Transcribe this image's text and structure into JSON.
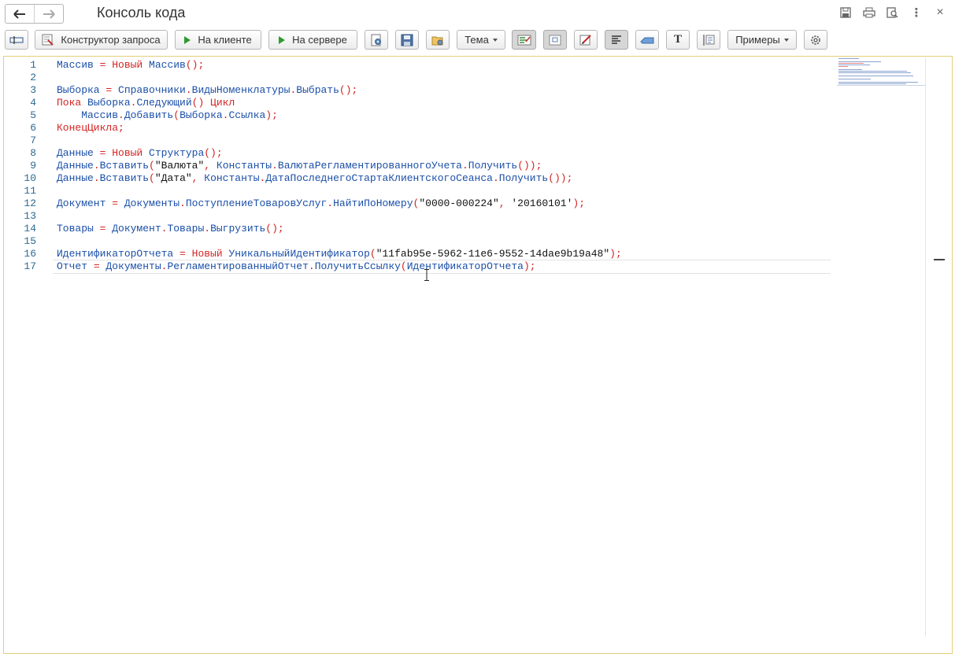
{
  "window": {
    "title": "Консоль кода",
    "nav_back": "back-arrow-icon",
    "nav_forward": "forward-arrow-icon",
    "window_icons": [
      "save-icon",
      "print-icon",
      "preview-icon",
      "more-icon",
      "close-icon"
    ],
    "close_glyph": "×",
    "more_glyph": "⋮"
  },
  "toolbar": {
    "query_builder_label": "Конструктор запроса",
    "run_client_label": "На клиенте",
    "run_server_label": "На сервере",
    "theme_label": "Тема",
    "examples_label": "Примеры",
    "text_button_label": "T"
  },
  "editor": {
    "current_line": 17,
    "lines": [
      {
        "n": "1",
        "tokens": [
          [
            "id",
            "Массив"
          ],
          [
            "op",
            " = "
          ],
          [
            "kw",
            "Новый"
          ],
          [
            "id",
            " Массив"
          ],
          [
            "op",
            "();"
          ]
        ]
      },
      {
        "n": "2",
        "tokens": []
      },
      {
        "n": "3",
        "tokens": [
          [
            "id",
            "Выборка"
          ],
          [
            "op",
            " = "
          ],
          [
            "id",
            "Справочники"
          ],
          [
            "op",
            "."
          ],
          [
            "id",
            "ВидыНоменклатуры"
          ],
          [
            "op",
            "."
          ],
          [
            "id",
            "Выбрать"
          ],
          [
            "op",
            "();"
          ]
        ]
      },
      {
        "n": "4",
        "tokens": [
          [
            "kw",
            "Пока"
          ],
          [
            "id",
            " Выборка"
          ],
          [
            "op",
            "."
          ],
          [
            "id",
            "Следующий"
          ],
          [
            "op",
            "() "
          ],
          [
            "kw",
            "Цикл"
          ]
        ]
      },
      {
        "n": "5",
        "tokens": [
          [
            "id",
            "    Массив"
          ],
          [
            "op",
            "."
          ],
          [
            "id",
            "Добавить"
          ],
          [
            "op",
            "("
          ],
          [
            "id",
            "Выборка"
          ],
          [
            "op",
            "."
          ],
          [
            "id",
            "Ссылка"
          ],
          [
            "op",
            ");"
          ]
        ]
      },
      {
        "n": "6",
        "tokens": [
          [
            "kw",
            "КонецЦикла"
          ],
          [
            "op",
            ";"
          ]
        ]
      },
      {
        "n": "7",
        "tokens": []
      },
      {
        "n": "8",
        "tokens": [
          [
            "id",
            "Данные"
          ],
          [
            "op",
            " = "
          ],
          [
            "kw",
            "Новый"
          ],
          [
            "id",
            " Структура"
          ],
          [
            "op",
            "();"
          ]
        ]
      },
      {
        "n": "9",
        "tokens": [
          [
            "id",
            "Данные"
          ],
          [
            "op",
            "."
          ],
          [
            "id",
            "Вставить"
          ],
          [
            "op",
            "("
          ],
          [
            "str",
            "\"Валюта\""
          ],
          [
            "op",
            ", "
          ],
          [
            "id",
            "Константы"
          ],
          [
            "op",
            "."
          ],
          [
            "id",
            "ВалютаРегламентированногоУчета"
          ],
          [
            "op",
            "."
          ],
          [
            "id",
            "Получить"
          ],
          [
            "op",
            "());"
          ]
        ]
      },
      {
        "n": "10",
        "tokens": [
          [
            "id",
            "Данные"
          ],
          [
            "op",
            "."
          ],
          [
            "id",
            "Вставить"
          ],
          [
            "op",
            "("
          ],
          [
            "str",
            "\"Дата\""
          ],
          [
            "op",
            ", "
          ],
          [
            "id",
            "Константы"
          ],
          [
            "op",
            "."
          ],
          [
            "id",
            "ДатаПоследнегоСтартаКлиентскогоСеанса"
          ],
          [
            "op",
            "."
          ],
          [
            "id",
            "Получить"
          ],
          [
            "op",
            "());"
          ]
        ]
      },
      {
        "n": "11",
        "tokens": []
      },
      {
        "n": "12",
        "tokens": [
          [
            "id",
            "Документ"
          ],
          [
            "op",
            " = "
          ],
          [
            "id",
            "Документы"
          ],
          [
            "op",
            "."
          ],
          [
            "id",
            "ПоступлениеТоваровУслуг"
          ],
          [
            "op",
            "."
          ],
          [
            "id",
            "НайтиПоНомеру"
          ],
          [
            "op",
            "("
          ],
          [
            "str",
            "\"0000-000224\""
          ],
          [
            "op",
            ", "
          ],
          [
            "str",
            "'20160101'"
          ],
          [
            "op",
            ");"
          ]
        ]
      },
      {
        "n": "13",
        "tokens": []
      },
      {
        "n": "14",
        "tokens": [
          [
            "id",
            "Товары"
          ],
          [
            "op",
            " = "
          ],
          [
            "id",
            "Документ"
          ],
          [
            "op",
            "."
          ],
          [
            "id",
            "Товары"
          ],
          [
            "op",
            "."
          ],
          [
            "id",
            "Выгрузить"
          ],
          [
            "op",
            "();"
          ]
        ]
      },
      {
        "n": "15",
        "tokens": []
      },
      {
        "n": "16",
        "tokens": [
          [
            "id",
            "ИдентификаторОтчета"
          ],
          [
            "op",
            " = "
          ],
          [
            "kw",
            "Новый"
          ],
          [
            "id",
            " УникальныйИдентификатор"
          ],
          [
            "op",
            "("
          ],
          [
            "str",
            "\"11fab95e-5962-11e6-9552-14dae9b19a48\""
          ],
          [
            "op",
            ");"
          ]
        ]
      },
      {
        "n": "17",
        "tokens": [
          [
            "id",
            "Отчет"
          ],
          [
            "op",
            " = "
          ],
          [
            "id",
            "Документы"
          ],
          [
            "op",
            "."
          ],
          [
            "id",
            "РегламентированныйОтчет"
          ],
          [
            "op",
            "."
          ],
          [
            "id",
            "ПолучитьСсылку"
          ],
          [
            "op",
            "("
          ],
          [
            "id",
            "ИдентификаторОтчета"
          ],
          [
            "op",
            ");"
          ]
        ]
      }
    ]
  }
}
